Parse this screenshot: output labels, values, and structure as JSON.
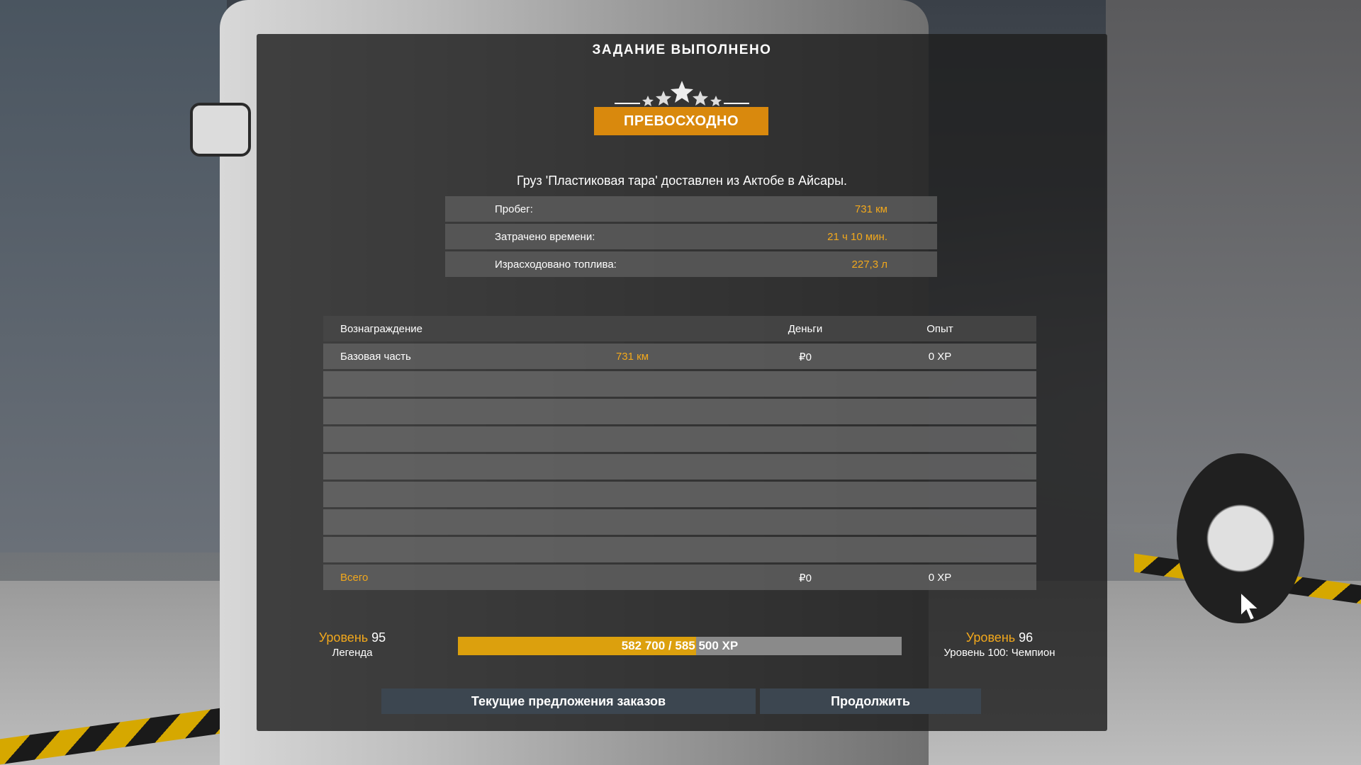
{
  "dialog": {
    "title": "ЗАДАНИЕ ВЫПОЛНЕНО",
    "grade": "ПРЕВОСХОДНО",
    "rating": {
      "value": 5,
      "max": 5
    },
    "delivery_text": "Груз 'Пластиковая тара' доставлен из Актобе в Айсары."
  },
  "stats": [
    {
      "label": "Пробег:",
      "value": "731 км"
    },
    {
      "label": "Затрачено времени:",
      "value": "21 ч 10 мин."
    },
    {
      "label": "Израсходовано топлива:",
      "value": "227,3 л"
    }
  ],
  "rewards": {
    "headers": {
      "name": "Вознаграждение",
      "money": "Деньги",
      "xp": "Опыт"
    },
    "rows": [
      {
        "name": "Базовая часть",
        "detail": "731 км",
        "money": "₽0",
        "xp": "0 XP"
      }
    ],
    "total": {
      "name": "Всего",
      "money": "₽0",
      "xp": "0 XP"
    }
  },
  "level": {
    "current_word": "Уровень",
    "current_num": "95",
    "current_title": "Легенда",
    "next_word": "Уровень",
    "next_num": "96",
    "next_title": "Уровень 100: Чемпион",
    "xp_text": "582 700 / 585 500 XP",
    "xp_current": 582700,
    "xp_max": 585500
  },
  "buttons": {
    "offers": "Текущие предложения заказов",
    "continue": "Продолжить"
  },
  "colors": {
    "accent": "#d9890d",
    "value_text": "#f2a81c",
    "xp_bar": "#dca00d"
  }
}
